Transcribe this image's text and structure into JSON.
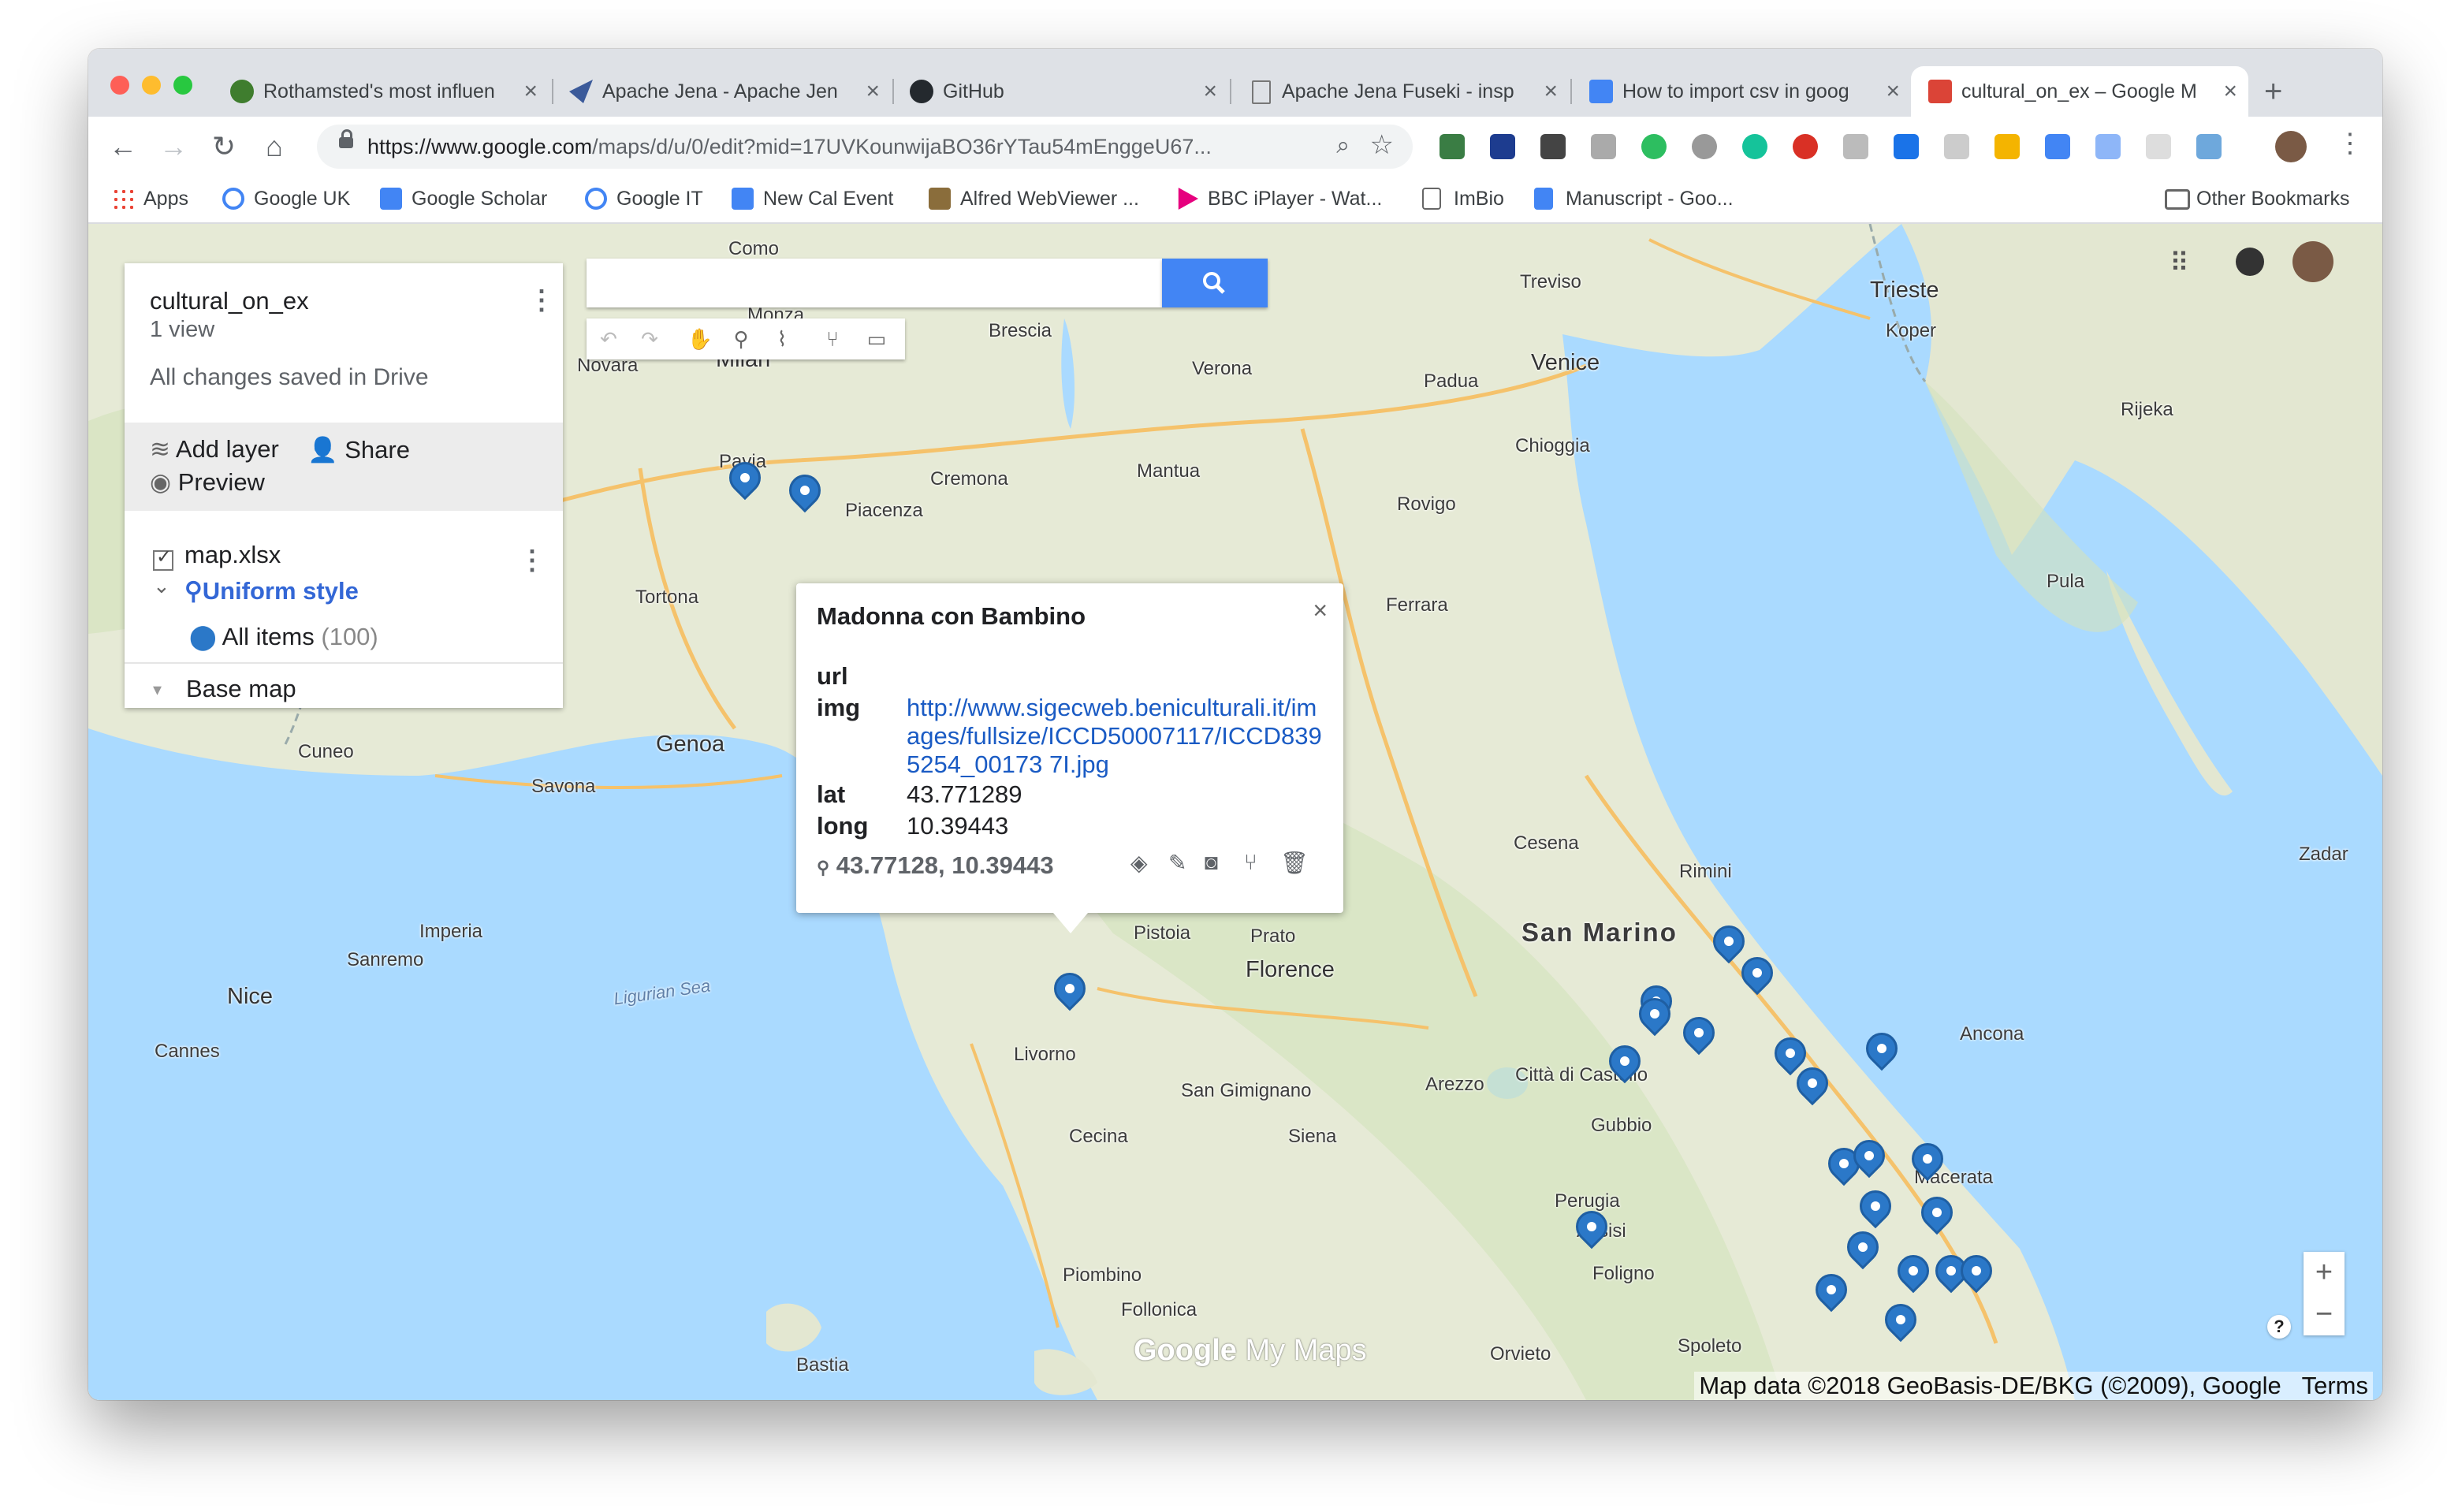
{
  "browser": {
    "tabs": [
      {
        "title": "Rothamsted's most influen",
        "favicon_color": "#3f7d2e"
      },
      {
        "title": "Apache Jena - Apache Jen",
        "favicon_color": "#3b5a9a"
      },
      {
        "title": "GitHub",
        "favicon_color": "#24292e"
      },
      {
        "title": "Apache Jena Fuseki - insp",
        "favicon_color": "#777777"
      },
      {
        "title": "How to import csv in goog",
        "favicon_color": "#4285f4"
      },
      {
        "title": "cultural_on_ex – Google M",
        "favicon_color": "#db4437",
        "active": true
      }
    ],
    "new_tab": "+",
    "url_host": "https://www.google.com",
    "url_path": "/maps/d/u/0/edit?mid=17UVKounwijaBO36rYTau54mEnggeU67...",
    "bookmarks": [
      {
        "label": "Apps",
        "icon": "apps-grid-icon"
      },
      {
        "label": "Google UK",
        "icon": "google-icon"
      },
      {
        "label": "Google Scholar",
        "icon": "scholar-icon"
      },
      {
        "label": "Google IT",
        "icon": "google-icon"
      },
      {
        "label": "New Cal Event",
        "icon": "calendar-icon"
      },
      {
        "label": "Alfred WebViewer ...",
        "icon": "alfred-icon"
      },
      {
        "label": "BBC iPlayer - Wat...",
        "icon": "iplayer-icon"
      },
      {
        "label": "ImBio",
        "icon": "page-icon"
      },
      {
        "label": "Manuscript - Goo...",
        "icon": "docs-icon"
      }
    ],
    "other_bookmarks": "Other Bookmarks"
  },
  "panel": {
    "title": "cultural_on_ex",
    "views": "1 view",
    "saved": "All changes saved in Drive",
    "add_layer": "Add layer",
    "share": "Share",
    "preview": "Preview",
    "layer_name": "map.xlsx",
    "uniform_style": "Uniform style",
    "all_items": "All items",
    "all_items_count": "(100)",
    "base_map": "Base map"
  },
  "popup": {
    "title": "Madonna con Bambino",
    "close": "×",
    "fields": {
      "url_key": "url",
      "img_key": "img",
      "img_value": "http://www.sigecweb.beniculturali.it/images/fullsize/ICCD50007117/ICCD8395254_00173 7I.jpg",
      "lat_key": "lat",
      "lat_value": "43.771289",
      "long_key": "long",
      "long_value": "10.39443"
    },
    "coords": "43.77128, 10.39443"
  },
  "map": {
    "places": [
      "Como",
      "Monza",
      "Milan",
      "Novara",
      "Brescia",
      "Verona",
      "Padua",
      "Venice",
      "Treviso",
      "Trieste",
      "Pavia",
      "Piacenza",
      "Cremona",
      "Mantua",
      "Rovigo",
      "Ferrara",
      "Chioggia",
      "Tortona",
      "Genoa",
      "Savona",
      "Cuneo",
      "Nice",
      "Cannes",
      "Sanremo",
      "Imperia",
      "Pistoia",
      "Prato",
      "Florence",
      "Livorno",
      "Siena",
      "Arezzo",
      "Gubbio",
      "Perugia",
      "Assisi",
      "Foligno",
      "Spoleto",
      "Orvieto",
      "Rimini",
      "Cesena",
      "San Marino",
      "Ancona",
      "Macerata",
      "Rijeka",
      "Koper",
      "Pula",
      "Zadar",
      "Bastia",
      "Piombino",
      "Follonica",
      "Cecina",
      "San Gimignano",
      "Città di Castello"
    ],
    "sea_label": "Ligurian Sea",
    "attribution": "Map data ©2018 GeoBasis-DE/BKG (©2009), Google",
    "terms": "Terms",
    "logo_google": "Google",
    "logo_mymaps": "My Maps",
    "zoom_in": "+",
    "zoom_out": "−",
    "help": "?"
  }
}
